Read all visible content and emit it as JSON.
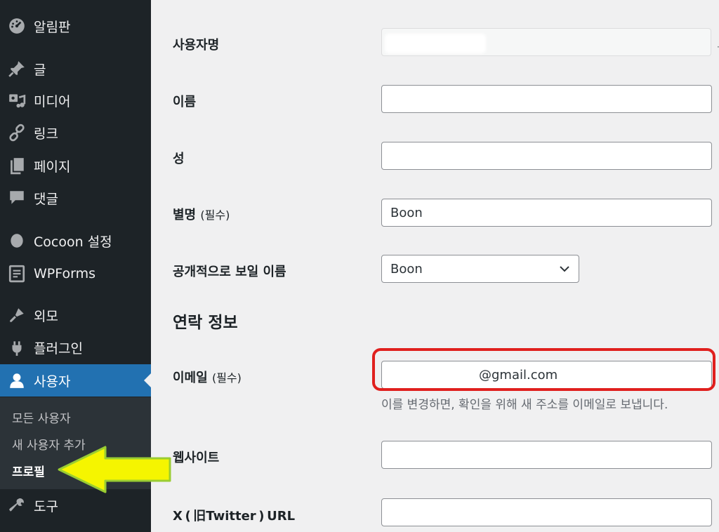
{
  "sidebar": {
    "items": [
      {
        "label": "알림판",
        "icon": "dashboard-icon"
      },
      {
        "label": "글",
        "icon": "pin-icon"
      },
      {
        "label": "미디어",
        "icon": "media-icon"
      },
      {
        "label": "링크",
        "icon": "link-icon"
      },
      {
        "label": "페이지",
        "icon": "page-icon"
      },
      {
        "label": "댓글",
        "icon": "comment-icon"
      },
      {
        "label": "Cocoon 설정",
        "icon": "circle-icon"
      },
      {
        "label": "WPForms",
        "icon": "forms-icon"
      },
      {
        "label": "외모",
        "icon": "brush-icon"
      },
      {
        "label": "플러그인",
        "icon": "plugin-icon"
      },
      {
        "label": "사용자",
        "icon": "user-icon"
      },
      {
        "label": "도구",
        "icon": "wrench-icon"
      }
    ],
    "submenu": [
      "모든 사용자",
      "새 사용자 추가",
      "프로필"
    ]
  },
  "form": {
    "username_label": "사용자명",
    "first_name_label": "이름",
    "last_name_label": "성",
    "nickname_label": "별명",
    "nickname_required": "(필수)",
    "nickname_value": "Boon",
    "display_name_label": "공개적으로 보일 이름",
    "display_name_value": "Boon",
    "contact_section": "연락 정보",
    "email_label": "이메일",
    "email_required": "(필수)",
    "email_value": "@gmail.com",
    "email_description": "이를 변경하면, 확인을 위해 새 주소를 이메일로 보냅니다.",
    "website_label": "웹사이트",
    "twitter_label": "X ( 旧Twitter ) URL"
  },
  "colors": {
    "sidebar_bg": "#1d2327",
    "active_bg": "#2271b1",
    "highlight_border": "#e0201e",
    "arrow_fill": "#f5f500",
    "arrow_stroke": "#9acd32"
  }
}
